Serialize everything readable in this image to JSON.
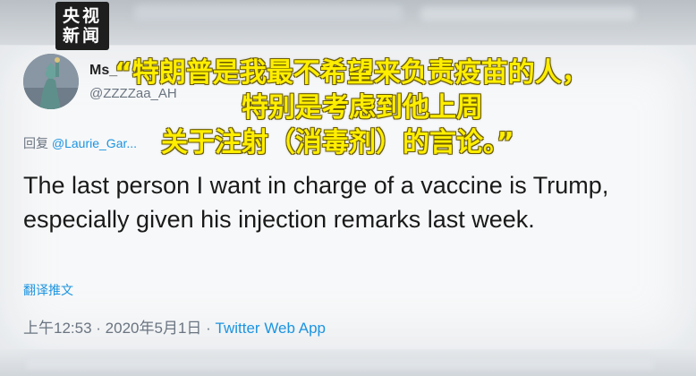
{
  "watermark": {
    "line1": "央视",
    "line2": "新闻"
  },
  "tweet": {
    "display_name": "Ms_",
    "handle": "@ZZZZaa_AH",
    "reply_label": "回复",
    "reply_to": "@Laurie_Gar...",
    "text": "The last person I want in charge of a vaccine is Trump, especially given his injection remarks last week.",
    "translate_label": "翻译推文",
    "time": "上午12:53",
    "date": "2020年5月1日",
    "source": "Twitter Web App"
  },
  "subtitle": {
    "line1": "“特朗普是我最不希望来负责疫苗的人，",
    "line2": "特别是考虑到他上周",
    "line3": "关于注射（消毒剂）的言论。”"
  },
  "colors": {
    "link": "#1c94e0",
    "subtitle": "#ffee00",
    "text": "#1a1a1a",
    "muted": "#6a7480"
  }
}
